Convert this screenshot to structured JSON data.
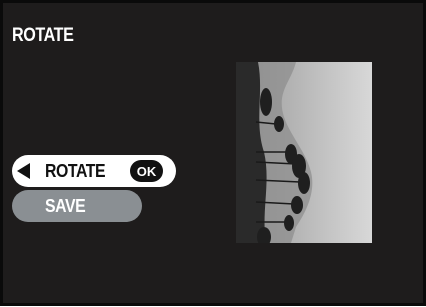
{
  "header": {
    "title": "ROTATE"
  },
  "menu": {
    "items": [
      {
        "label": "ROTATE",
        "selected": true,
        "arrow_icon": "left-triangle-icon",
        "badge": "OK"
      },
      {
        "label": "SAVE",
        "selected": false
      }
    ]
  },
  "preview": {
    "icon": "rotated-landscape-photo"
  },
  "colors": {
    "screen_background": "#1e1c1c",
    "selected_item": "#ffffff",
    "unselected_item": "#8a8f93",
    "badge": "#111111"
  }
}
